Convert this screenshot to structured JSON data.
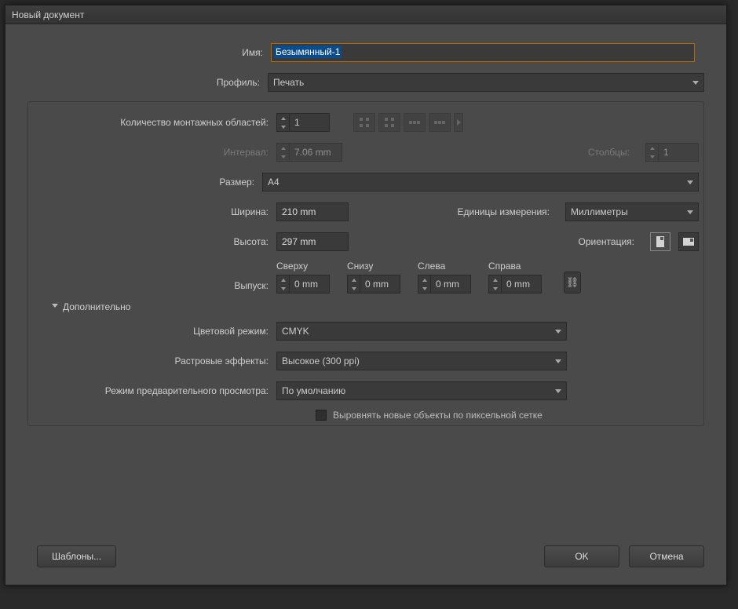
{
  "window": {
    "title": "Новый документ"
  },
  "fields": {
    "name_label": "Имя:",
    "name_value": "Безымянный-1",
    "profile_label": "Профиль:",
    "profile_value": "Печать",
    "artboards_label": "Количество монтажных областей:",
    "artboards_value": "1",
    "spacing_label": "Интервал:",
    "spacing_value": "7.06 mm",
    "columns_label": "Столбцы:",
    "columns_value": "1",
    "size_label": "Размер:",
    "size_value": "A4",
    "width_label": "Ширина:",
    "width_value": "210 mm",
    "units_label": "Единицы измерения:",
    "units_value": "Миллиметры",
    "height_label": "Высота:",
    "height_value": "297 mm",
    "orientation_label": "Ориентация:",
    "bleed_label": "Выпуск:",
    "bleed": {
      "top_label": "Сверху",
      "top_value": "0 mm",
      "bottom_label": "Снизу",
      "bottom_value": "0 mm",
      "left_label": "Слева",
      "left_value": "0 mm",
      "right_label": "Справа",
      "right_value": "0 mm"
    },
    "advanced_label": "Дополнительно",
    "color_mode_label": "Цветовой режим:",
    "color_mode_value": "CMYK",
    "raster_label": "Растровые эффекты:",
    "raster_value": "Высокое (300 ppi)",
    "preview_label": "Режим предварительного просмотра:",
    "preview_value": "По умолчанию",
    "align_pixel_label": "Выровнять новые объекты по пиксельной сетке"
  },
  "buttons": {
    "templates": "Шаблоны...",
    "ok": "OK",
    "cancel": "Отмена"
  }
}
